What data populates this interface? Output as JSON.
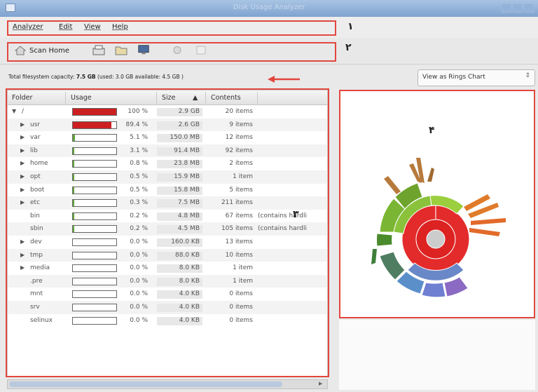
{
  "window": {
    "title": "Disk Usage Analyzer"
  },
  "menu": [
    {
      "label": "Analyzer"
    },
    {
      "label": "Edit"
    },
    {
      "label": "View"
    },
    {
      "label": "Help"
    }
  ],
  "toolbar": {
    "scan_home_label": "Scan Home"
  },
  "capacity": {
    "label": "Total filesystem capacity:",
    "total": "7.5 GB",
    "used_label": "(used:",
    "used": "3.0 GB",
    "available_label": "available:",
    "available": "4.5 GB )"
  },
  "view_select": {
    "selected": "View as Rings Chart"
  },
  "columns": {
    "folder": "Folder",
    "usage": "Usage",
    "size": "Size",
    "sort_glyph": "▲",
    "contents": "Contents"
  },
  "rows": [
    {
      "name": "/",
      "expander": "▼",
      "pct": "100 %",
      "size": "2.9 GB",
      "items": "20 items",
      "note": "",
      "usage": 1.0
    },
    {
      "name": "usr",
      "expander": "▶",
      "pct": "89.4 %",
      "size": "2.6 GB",
      "items": "9 items",
      "note": "",
      "usage": 0.894
    },
    {
      "name": "var",
      "expander": "▶",
      "pct": "5.1 %",
      "size": "150.0 MB",
      "items": "12 items",
      "note": "",
      "usage": 0.051
    },
    {
      "name": "lib",
      "expander": "▶",
      "pct": "3.1 %",
      "size": "91.4 MB",
      "items": "92 items",
      "note": "",
      "usage": 0.031
    },
    {
      "name": "home",
      "expander": "▶",
      "pct": "0.8 %",
      "size": "23.8 MB",
      "items": "2 items",
      "note": "",
      "usage": 0.008
    },
    {
      "name": "opt",
      "expander": "▶",
      "pct": "0.5 %",
      "size": "15.9 MB",
      "items": "1 item",
      "note": "",
      "usage": 0.005
    },
    {
      "name": "boot",
      "expander": "▶",
      "pct": "0.5 %",
      "size": "15.8 MB",
      "items": "5 items",
      "note": "",
      "usage": 0.005
    },
    {
      "name": "etc",
      "expander": "▶",
      "pct": "0.3 %",
      "size": "7.5 MB",
      "items": "211 items",
      "note": "",
      "usage": 0.003
    },
    {
      "name": "bin",
      "expander": "",
      "pct": "0.2 %",
      "size": "4.8 MB",
      "items": "67 items",
      "note": "(contains hardli",
      "usage": 0.002
    },
    {
      "name": "sbin",
      "expander": "",
      "pct": "0.2 %",
      "size": "4.5 MB",
      "items": "105 items",
      "note": "(contains hardli",
      "usage": 0.002
    },
    {
      "name": "dev",
      "expander": "▶",
      "pct": "0.0 %",
      "size": "160.0 KB",
      "items": "13 items",
      "note": "",
      "usage": 0.0
    },
    {
      "name": "tmp",
      "expander": "▶",
      "pct": "0.0 %",
      "size": "88.0 KB",
      "items": "10 items",
      "note": "",
      "usage": 0.0
    },
    {
      "name": "media",
      "expander": "▶",
      "pct": "0.0 %",
      "size": "8.0 KB",
      "items": "1 item",
      "note": "",
      "usage": 0.0
    },
    {
      "name": ".pre",
      "expander": "",
      "pct": "0.0 %",
      "size": "8.0 KB",
      "items": "1 item",
      "note": "",
      "usage": 0.0
    },
    {
      "name": "mnt",
      "expander": "",
      "pct": "0.0 %",
      "size": "4.0 KB",
      "items": "0 items",
      "note": "",
      "usage": 0.0
    },
    {
      "name": "srv",
      "expander": "",
      "pct": "0.0 %",
      "size": "4.0 KB",
      "items": "0 items",
      "note": "",
      "usage": 0.0
    },
    {
      "name": "selinux",
      "expander": "",
      "pct": "0.0 %",
      "size": "4.0 KB",
      "items": "0 items",
      "note": "",
      "usage": 0.0
    }
  ],
  "annotations": {
    "one": "١",
    "two": "٢",
    "three": "٣",
    "four": "۴"
  },
  "colors": {
    "highlight": "#e2473f",
    "usage_fill": "#cc2020",
    "ring_center": "#cccccc"
  }
}
